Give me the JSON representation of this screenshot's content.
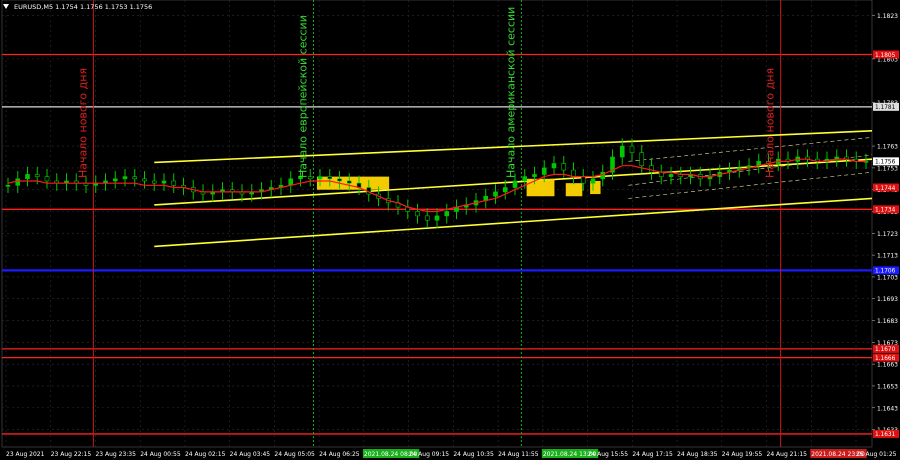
{
  "header": {
    "symbol_info": "EURUSD,M5  1.1754 1.1756 1.1753 1.1756"
  },
  "colors": {
    "background": "#000000",
    "grid": "#2a2f2a",
    "bull": "#00c800",
    "wick": "#00c800",
    "ma": "#ff1a1a",
    "channel": "#ffff33",
    "dashed": "#e6e6a0",
    "support_resistance": "#ff2020",
    "blue_level": "#1a1aff",
    "white_level": "#dddddd",
    "session_line": "#18b018",
    "day_line": "#cc1a1a",
    "box": "#ffd700",
    "axis_text": "#ffffff",
    "price_tag_bg": "#e01010",
    "current_tag_bg": "#ffffff"
  },
  "chart_data": {
    "type": "candlestick",
    "title": "EURUSD,M5",
    "ylim": [
      1.1625,
      1.183
    ],
    "y_ticks": [
      "1.1823",
      "1.1803",
      "1.1783",
      "1.1763",
      "1.1753",
      "1.1743",
      "1.1733",
      "1.1723",
      "1.1713",
      "1.1703",
      "1.1693",
      "1.1683",
      "1.1673",
      "1.1663",
      "1.1653",
      "1.1643",
      "1.1633"
    ],
    "x_ticks": [
      "23 Aug 2021",
      "23 Aug 22:15",
      "23 Aug 23:35",
      "24 Aug 00:55",
      "24 Aug 02:15",
      "24 Aug 03:45",
      "24 Aug 05:05",
      "24 Aug 06:25",
      "2021.08.24 08:00",
      "24 Aug 09:15",
      "24 Aug 10:35",
      "24 Aug 11:55",
      "2021.08.24 13:00",
      "24 Aug 15:55",
      "24 Aug 17:15",
      "24 Aug 18:35",
      "24 Aug 19:55",
      "24 Aug 21:15",
      "2021.08.24 23:00",
      "25 Aug 01:25"
    ],
    "x_tick_highlight": {
      "2021.08.24 08:00": "session",
      "2021.08.24 13:00": "session",
      "2021.08.24 23:00": "day"
    },
    "close_series": [
      1.1745,
      1.1748,
      1.175,
      1.1749,
      1.1747,
      1.1746,
      1.1747,
      1.1746,
      1.1745,
      1.1746,
      1.1747,
      1.1748,
      1.1749,
      1.1748,
      1.1747,
      1.1746,
      1.1747,
      1.1745,
      1.1744,
      1.1742,
      1.1741,
      1.1742,
      1.1743,
      1.1742,
      1.1741,
      1.1742,
      1.1743,
      1.1744,
      1.1745,
      1.1748,
      1.1749,
      1.1748,
      1.1749,
      1.1748,
      1.1747,
      1.1746,
      1.1744,
      1.1741,
      1.1739,
      1.1737,
      1.1735,
      1.1733,
      1.1731,
      1.1729,
      1.1731,
      1.1733,
      1.1735,
      1.1736,
      1.1738,
      1.174,
      1.1742,
      1.1744,
      1.1747,
      1.1749,
      1.175,
      1.1753,
      1.1755,
      1.1752,
      1.1749,
      1.1746,
      1.1748,
      1.1751,
      1.1758,
      1.1763,
      1.176,
      1.1754,
      1.1751,
      1.1749,
      1.175,
      1.1749,
      1.175,
      1.1748,
      1.1749,
      1.1751,
      1.1752,
      1.1753,
      1.1754,
      1.1756,
      1.1755,
      1.1757,
      1.1756,
      1.1758,
      1.1757,
      1.1756,
      1.1757,
      1.1758,
      1.1757,
      1.1756,
      1.1756
    ],
    "ma_series": [
      1.1746,
      1.1747,
      1.1747,
      1.1747,
      1.1746,
      1.1746,
      1.1746,
      1.1746,
      1.1746,
      1.1746,
      1.1746,
      1.1746,
      1.1746,
      1.1746,
      1.1745,
      1.1745,
      1.1745,
      1.1744,
      1.1744,
      1.1743,
      1.1742,
      1.1742,
      1.1742,
      1.1742,
      1.1742,
      1.1742,
      1.1742,
      1.1743,
      1.1744,
      1.1745,
      1.1746,
      1.1747,
      1.1747,
      1.1747,
      1.1746,
      1.1745,
      1.1744,
      1.1742,
      1.174,
      1.1738,
      1.1737,
      1.1735,
      1.1734,
      1.1733,
      1.1733,
      1.1734,
      1.1735,
      1.1736,
      1.1737,
      1.1738,
      1.1739,
      1.1741,
      1.1743,
      1.1745,
      1.1747,
      1.1749,
      1.175,
      1.175,
      1.1749,
      1.1749,
      1.1749,
      1.175,
      1.1752,
      1.1754,
      1.1754,
      1.1753,
      1.1752,
      1.1751,
      1.1751,
      1.175,
      1.175,
      1.1749,
      1.1749,
      1.175,
      1.1751,
      1.1752,
      1.1753,
      1.1754,
      1.1755,
      1.1756,
      1.1756,
      1.1757,
      1.1757,
      1.1756,
      1.1756,
      1.1757,
      1.1757,
      1.1756,
      1.1756
    ],
    "horizontal_levels": [
      {
        "price": 1.1805,
        "label": "1.1805",
        "kind": "red"
      },
      {
        "price": 1.1781,
        "label": "1.1781",
        "kind": "white"
      },
      {
        "price": 1.1734,
        "label": "1.1734",
        "kind": "red"
      },
      {
        "price": 1.1706,
        "label": "1.1706",
        "kind": "blue"
      },
      {
        "price": 1.167,
        "label": "1.1670",
        "kind": "red"
      },
      {
        "price": 1.1666,
        "label": "1.1666",
        "kind": "red"
      },
      {
        "price": 1.1631,
        "label": "1.1631",
        "kind": "red"
      }
    ],
    "price_tags": [
      {
        "price": 1.1756,
        "label": "1.1756",
        "kind": "current"
      },
      {
        "price": 1.1744,
        "label": "1.1744",
        "kind": "red"
      }
    ],
    "channel": {
      "upper": {
        "start": [
          0.175,
          1.17555
        ],
        "end": [
          1.0,
          1.177
        ]
      },
      "middle": {
        "start": [
          0.175,
          1.1736
        ],
        "end": [
          1.0,
          1.1757
        ]
      },
      "lower": {
        "start": [
          0.175,
          1.1717
        ],
        "end": [
          1.0,
          1.1739
        ]
      }
    },
    "vertical_markers": [
      {
        "x": 0.105,
        "label": "Начало нового дня",
        "kind": "day"
      },
      {
        "x": 0.358,
        "label": "Начало европейской сессии",
        "kind": "session"
      },
      {
        "x": 0.597,
        "label": "Начало американской сессии",
        "kind": "session"
      },
      {
        "x": 0.895,
        "label": "Начало нового дня",
        "kind": "day"
      }
    ]
  }
}
